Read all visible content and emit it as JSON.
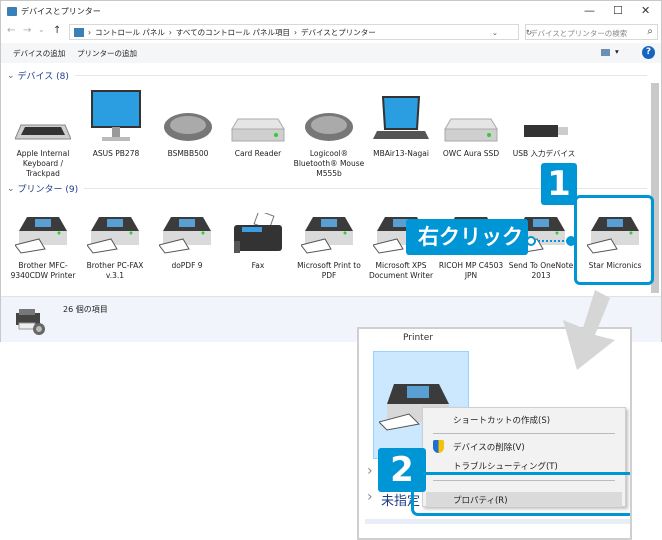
{
  "window": {
    "title": "デバイスとプリンター",
    "minimize": "—",
    "maximize": "☐",
    "close": "✕"
  },
  "address": {
    "back": "←",
    "forward": "→",
    "recent": "⌄",
    "up": "↑",
    "breadcrumb": [
      "コントロール パネル",
      "すべてのコントロール パネル項目",
      "デバイスとプリンター"
    ],
    "dropdown": "⌄",
    "refresh": "↻",
    "search_placeholder": "デバイスとプリンターの検索",
    "search_icon": "⌕"
  },
  "toolbar": {
    "add_device": "デバイスの追加",
    "add_printer": "プリンターの追加",
    "view_arrow": "▾",
    "help": "?"
  },
  "devices": {
    "header": "デバイス (8)",
    "items": [
      {
        "label": "Apple Internal Keyboard / Trackpad",
        "icon": "keyboard-icon"
      },
      {
        "label": "ASUS PB278",
        "icon": "monitor-icon"
      },
      {
        "label": "BSMBB500",
        "icon": "mouse-icon"
      },
      {
        "label": "Card Reader",
        "icon": "drive-icon"
      },
      {
        "label": "Logicool® Bluetooth® Mouse M555b",
        "icon": "mouse-icon"
      },
      {
        "label": "MBAir13-Nagai",
        "icon": "laptop-icon"
      },
      {
        "label": "OWC Aura SSD",
        "icon": "drive-icon"
      },
      {
        "label": "USB 入力デバイス",
        "icon": "usb-icon"
      }
    ]
  },
  "printers": {
    "header": "プリンター (9)",
    "items": [
      {
        "label": "Brother MFC-9340CDW Printer",
        "icon": "printer-icon"
      },
      {
        "label": "Brother PC-FAX v.3.1",
        "icon": "printer-icon"
      },
      {
        "label": "doPDF 9",
        "icon": "printer-icon"
      },
      {
        "label": "Fax",
        "icon": "fax-icon"
      },
      {
        "label": "Microsoft Print to PDF",
        "icon": "printer-icon"
      },
      {
        "label": "Microsoft XPS Document Writer",
        "icon": "printer-icon"
      },
      {
        "label": "RICOH MP C4503 JPN",
        "icon": "printer-icon"
      },
      {
        "label": "Send To OneNote 2013",
        "icon": "printer-icon"
      },
      {
        "label": "Star Micronics",
        "icon": "printer-icon"
      }
    ]
  },
  "status": {
    "count": "26 個の項目"
  },
  "annotations": {
    "step1": "1",
    "right_click": "右クリック",
    "step2": "2",
    "accent": "#0096d6"
  },
  "callout": {
    "partial_label": "Printer",
    "group_partial": "未指定",
    "context_menu": [
      {
        "label": "ショートカットの作成(S)"
      },
      {
        "label": "デバイスの削除(V)",
        "icon": "shield-icon"
      },
      {
        "label": "トラブルシューティング(T)"
      },
      {
        "label": "プロパティ(R)",
        "highlighted": true
      }
    ]
  }
}
